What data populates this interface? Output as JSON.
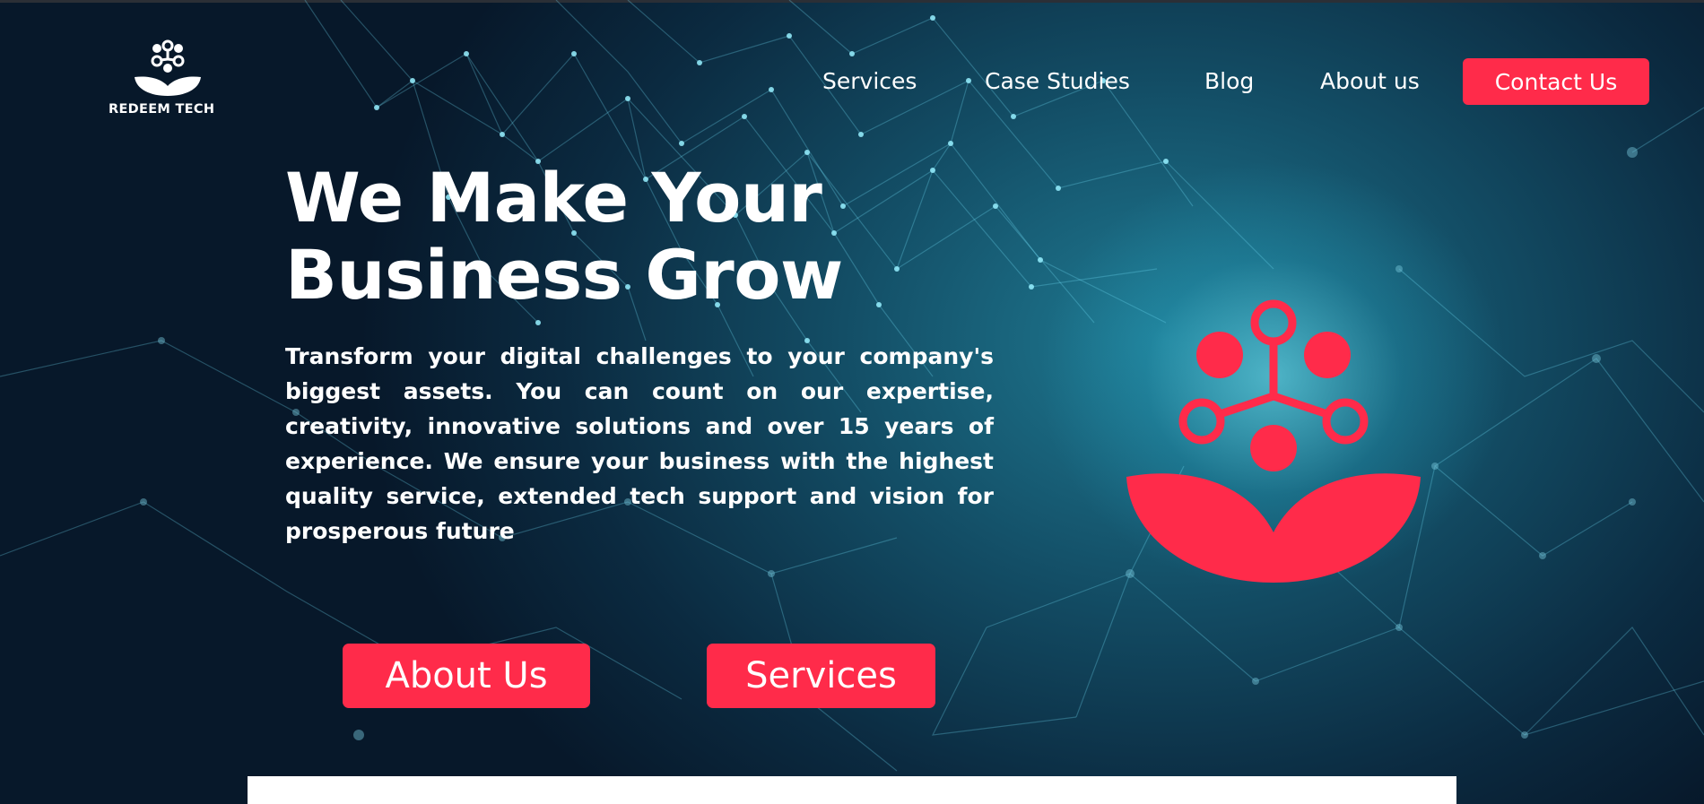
{
  "brand": {
    "name": "REDEEM TECH",
    "accent_color": "#ff2b4a",
    "logo_icon": "redeem-tech-flower-molecule-icon"
  },
  "nav": {
    "items": [
      {
        "label": "Services"
      },
      {
        "label": "Case Studies"
      },
      {
        "label": "Blog"
      },
      {
        "label": "About us"
      }
    ],
    "contact_label": "Contact Us"
  },
  "hero": {
    "headline_line1": "We Make Your",
    "headline_line2": "Business Grow",
    "description": "Transform your digital challenges to your company's biggest assets. You can count on our expertise, creativity, innovative solutions and over 15 years of experience. We ensure your business with the highest quality service, extended tech support and vision for prosperous future",
    "buttons": {
      "about_label": "About Us",
      "services_label": "Services"
    },
    "emblem_icon": "redeem-tech-emblem-icon"
  }
}
